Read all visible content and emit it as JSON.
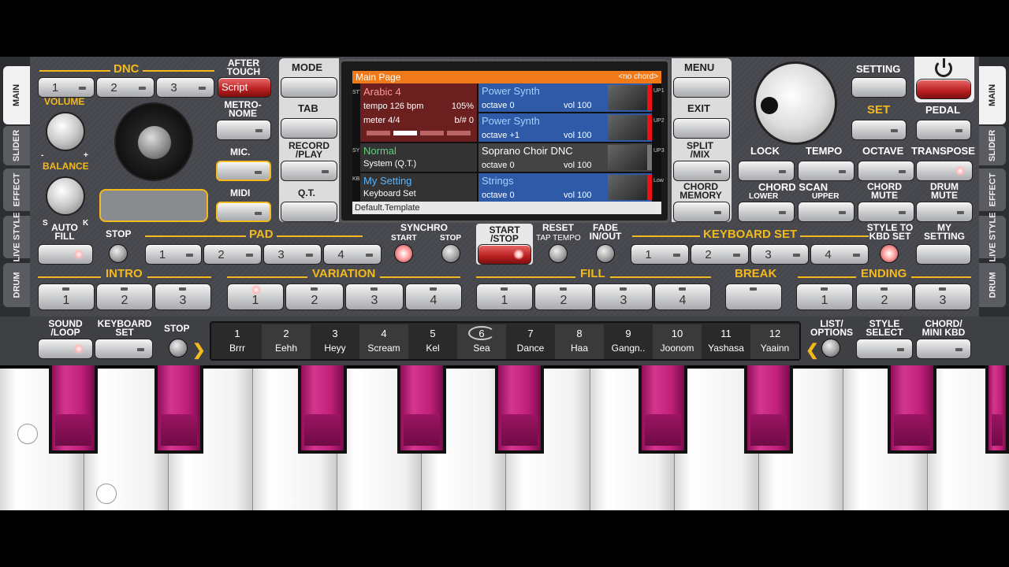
{
  "tabs_left": [
    "MAIN",
    "SLIDER",
    "EFFECT",
    "LIVE STYLE",
    "DRUM"
  ],
  "tabs_right": [
    "MAIN",
    "SLIDER",
    "EFFECT",
    "LIVE STYLE",
    "DRUM"
  ],
  "labels": {
    "dnc": "DNC",
    "after_touch": "AFTER TOUCH",
    "volume": "VOLUME",
    "balance": "BALANCE",
    "metronome": "METRO-NOME",
    "mic": "MIC.",
    "midi": "MIDI",
    "mode": "MODE",
    "tab": "TAB",
    "record_play": "RECORD /PLAY",
    "qt": "Q.T.",
    "menu": "MENU",
    "exit": "EXIT",
    "split_mix": "SPLIT /MIX",
    "chord_memory": "CHORD MEMORY",
    "setting": "SETTING",
    "set": "SET",
    "pedal": "PEDAL",
    "lock": "LOCK",
    "tempo": "TEMPO",
    "octave": "OCTAVE",
    "transpose": "TRANSPOSE",
    "chord_scan": "CHORD SCAN",
    "lower": "LOWER",
    "upper": "UPPER",
    "chord_mute": "CHORD MUTE",
    "drum_mute": "DRUM MUTE",
    "auto_fill": "AUTO FILL",
    "stop": "STOP",
    "pad": "PAD",
    "synchro": "SYNCHRO",
    "sync_start": "START",
    "sync_stop": "STOP",
    "start_stop": "START /STOP",
    "reset": "RESET",
    "tap_tempo": "TAP TEMPO",
    "fade": "FADE IN/OUT",
    "keyboard_set": "KEYBOARD SET",
    "style_to_kbd": "STYLE TO KBD SET",
    "my_setting": "MY SETTING",
    "intro": "INTRO",
    "variation": "VARIATION",
    "fill": "FILL",
    "break": "BREAK",
    "ending": "ENDING",
    "sound_loop": "SOUND /LOOP",
    "keyboard_set2": "KEYBOARD SET",
    "stop2": "STOP",
    "list_options": "LIST/ OPTIONS",
    "style_select": "STYLE SELECT",
    "chord_mini": "CHORD/ MINI KBD",
    "script": "Script",
    "bal_s": "S",
    "bal_k": "K",
    "vol_minus": "-",
    "vol_plus": "+"
  },
  "dnc_buttons": [
    "1",
    "2",
    "3"
  ],
  "pad_buttons": [
    "1",
    "2",
    "3",
    "4"
  ],
  "kbd_buttons": [
    "1",
    "2",
    "3",
    "4"
  ],
  "intro_buttons": [
    "1",
    "2",
    "3"
  ],
  "variation_buttons": [
    "1",
    "2",
    "3",
    "4"
  ],
  "fill_buttons": [
    "1",
    "2",
    "3",
    "4"
  ],
  "ending_buttons": [
    "1",
    "2",
    "3"
  ],
  "screen": {
    "title": "Main Page",
    "chord": "<no chord>",
    "style_name": "Arabic 4",
    "tempo": "tempo 126 bpm",
    "tempo_pct": "105%",
    "meter": "meter 4/4",
    "bsharp": "b/# 0",
    "sys_name": "Normal",
    "sys_sub": "System (Q.T.)",
    "kbd_name": "My Setting",
    "kbd_sub": "Keyboard Set",
    "footer": "Default.Template",
    "side_style": "STYLE",
    "side_sys": "SYS",
    "side_kbd": "KBD",
    "parts": [
      {
        "name": "Power Synth",
        "octave": "octave  0",
        "vol": "vol 100",
        "tag": "UP1",
        "color": "#2e5aa8"
      },
      {
        "name": "Power Synth",
        "octave": "octave +1",
        "vol": "vol 100",
        "tag": "UP2",
        "color": "#2e5aa8"
      },
      {
        "name": "Soprano Choir DNC",
        "octave": "octave  0",
        "vol": "vol 100",
        "tag": "UP3",
        "color": "#444"
      },
      {
        "name": "Strings",
        "octave": "octave  0",
        "vol": "vol 100",
        "tag": "Low",
        "color": "#2e5aa8"
      }
    ]
  },
  "favorites": [
    {
      "n": "1",
      "t": "Brrr"
    },
    {
      "n": "2",
      "t": "Eehh"
    },
    {
      "n": "3",
      "t": "Heyy"
    },
    {
      "n": "4",
      "t": "Scream"
    },
    {
      "n": "5",
      "t": "Kel"
    },
    {
      "n": "6",
      "t": "Sea"
    },
    {
      "n": "7",
      "t": "Dance"
    },
    {
      "n": "8",
      "t": "Haa"
    },
    {
      "n": "9",
      "t": "Gangn.."
    },
    {
      "n": "10",
      "t": "Joonom"
    },
    {
      "n": "11",
      "t": "Yashasa"
    },
    {
      "n": "12",
      "t": "Yaainn"
    }
  ]
}
